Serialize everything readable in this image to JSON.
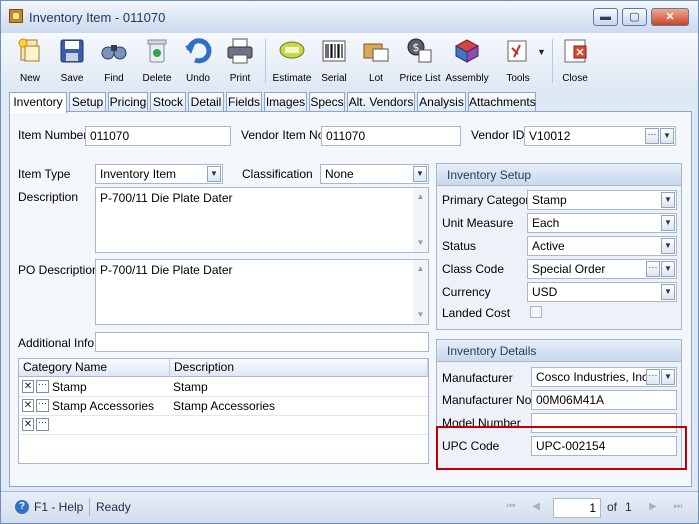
{
  "window": {
    "title": "Inventory Item - 011070",
    "minimize": "▬",
    "maximize": "▢",
    "close": "✕"
  },
  "toolbar": [
    {
      "label": "New",
      "icon": "new-icon"
    },
    {
      "label": "Save",
      "icon": "save-icon"
    },
    {
      "label": "Find",
      "icon": "find-icon"
    },
    {
      "label": "Delete",
      "icon": "delete-icon"
    },
    {
      "label": "Undo",
      "icon": "undo-icon"
    },
    {
      "label": "Print",
      "icon": "print-icon"
    },
    {
      "label": "Estimate",
      "icon": "estimate-icon"
    },
    {
      "label": "Serial",
      "icon": "serial-icon"
    },
    {
      "label": "Lot",
      "icon": "lot-icon"
    },
    {
      "label": "Price List",
      "icon": "price-list-icon"
    },
    {
      "label": "Assembly",
      "icon": "assembly-icon"
    },
    {
      "label": "Tools",
      "icon": "tools-icon"
    },
    {
      "label": "Close",
      "icon": "close-icon"
    }
  ],
  "tabs": [
    "Inventory",
    "Setup",
    "Pricing",
    "Stock",
    "Detail",
    "Fields",
    "Images",
    "Specs",
    "Alt. Vendors",
    "Analysis",
    "Attachments"
  ],
  "header": {
    "item_number_label": "Item Number",
    "item_number": "011070",
    "vendor_item_no_label": "Vendor Item No",
    "vendor_item_no": "011070",
    "vendor_id_label": "Vendor ID",
    "vendor_id": "V10012"
  },
  "left": {
    "item_type_label": "Item Type",
    "item_type": "Inventory Item",
    "classification_label": "Classification",
    "classification": "None",
    "description_label": "Description",
    "description": "P-700/11 Die Plate Dater",
    "po_description_label": "PO Description",
    "po_description": "P-700/11 Die Plate Dater",
    "additional_info_label": "Additional Info",
    "additional_info": ""
  },
  "category_grid": {
    "columns": [
      "Category Name",
      "Description"
    ],
    "rows": [
      {
        "name": "Stamp",
        "description": "Stamp"
      },
      {
        "name": "Stamp Accessories",
        "description": "Stamp Accessories"
      }
    ]
  },
  "inventory_setup": {
    "title": "Inventory Setup",
    "primary_category_label": "Primary Category",
    "primary_category": "Stamp",
    "unit_measure_label": "Unit Measure",
    "unit_measure": "Each",
    "status_label": "Status",
    "status": "Active",
    "class_code_label": "Class Code",
    "class_code": "Special Order",
    "currency_label": "Currency",
    "currency": "USD",
    "landed_cost_label": "Landed Cost",
    "landed_cost": false
  },
  "inventory_details": {
    "title": "Inventory Details",
    "manufacturer_label": "Manufacturer",
    "manufacturer": "Cosco Industries, Inc.",
    "manufacturer_no_label": "Manufacturer No",
    "manufacturer_no": "00M06M41A",
    "model_number_label": "Model Number",
    "model_number": "",
    "upc_code_label": "UPC Code",
    "upc_code": "UPC-002154"
  },
  "status_bar": {
    "help": "F1 - Help",
    "status": "Ready",
    "page": "1",
    "of_label": "of",
    "total": "1"
  },
  "colors": {
    "highlight": "#c00000",
    "accent": "#1e395b"
  }
}
